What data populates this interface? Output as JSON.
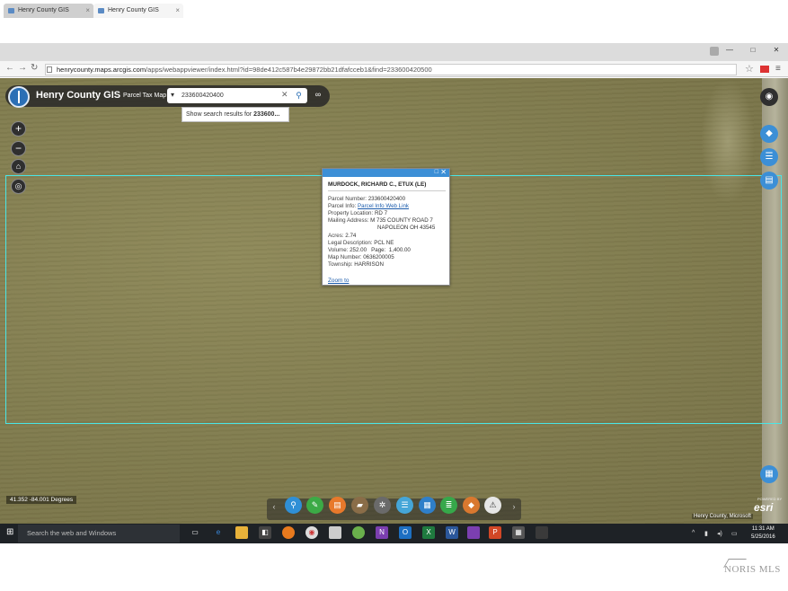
{
  "browser": {
    "tabs": [
      {
        "label": "Henry County GIS",
        "active": false
      },
      {
        "label": "Henry County GIS",
        "active": true
      }
    ],
    "url_host": "henrycounty.maps.arcgis.com",
    "url_path": "/apps/webappviewer/index.html?id=98de412c587b4e29872bb21dfafcceb1&find=233600420500"
  },
  "app": {
    "title": "Henry County GIS",
    "subtitle": "Parcel Tax Map",
    "search_value": "233600420400",
    "suggestion_prefix": "Show search results for ",
    "suggestion_term": "233600..."
  },
  "popup": {
    "title": "MURDOCK, RICHARD C., ETUX (LE)",
    "fields": [
      {
        "label": "Parcel Number:",
        "value": "233600420400"
      },
      {
        "label": "Parcel Info:",
        "value": "Parcel Info Web Link",
        "link": true
      },
      {
        "label": "Property Location:",
        "value": "RD 7"
      },
      {
        "label": "Mailing Address:",
        "value": "M 735 COUNTY ROAD 7"
      },
      {
        "label": "",
        "value": "NAPOLEON OH 43545"
      },
      {
        "label": "Acres:",
        "value": "2.74"
      },
      {
        "label": "Legal Description:",
        "value": "PCL NE"
      },
      {
        "label": "Volume:",
        "value": "252.00   Page:  1,400.00"
      },
      {
        "label": "Map Number:",
        "value": "0636200005"
      },
      {
        "label": "Township:",
        "value": "HARRISON"
      }
    ],
    "zoom_link": "Zoom to"
  },
  "map": {
    "coordinates": "41.352 -84.001 Degrees",
    "attribution": "Henry County, Microsoft",
    "esri": "esri",
    "powered_by": "POWERED BY",
    "toolbar_colors": [
      "#2f8fd6",
      "#3caa46",
      "#e8792b",
      "#8a6d48",
      "#6a6a6a",
      "#45a6d8",
      "#2f7fc9",
      "#36a84a",
      "#d9782f",
      "#e6e6e6"
    ]
  },
  "taskbar": {
    "search_placeholder": "Search the web and Windows",
    "time": "11:31 AM",
    "date": "5/25/2016"
  },
  "watermark": "NORIS MLS"
}
